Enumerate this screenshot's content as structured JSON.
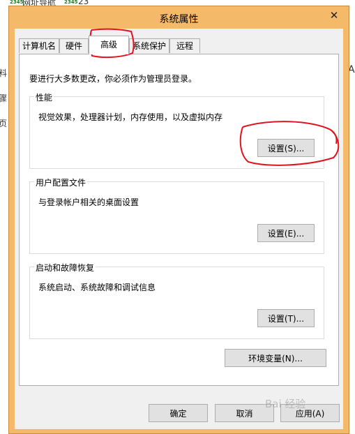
{
  "background": {
    "top_link": "网址导航",
    "top_num": "23",
    "badge": "2345",
    "left_fragments": [
      "料",
      "骤",
      "页"
    ],
    "right_fragment": "A"
  },
  "window": {
    "title": "系统属性",
    "close_glyph": "✕"
  },
  "tabs": [
    {
      "label": "计算机名"
    },
    {
      "label": "硬件"
    },
    {
      "label": "高级"
    },
    {
      "label": "系统保护"
    },
    {
      "label": "远程"
    }
  ],
  "active_tab": "高级",
  "admin_note": "要进行大多数更改，你必须作为管理员登录。",
  "groups": {
    "performance": {
      "title": "性能",
      "desc": "视觉效果，处理器计划，内存使用，以及虚拟内存",
      "button": "设置(S)..."
    },
    "user_profiles": {
      "title": "用户配置文件",
      "desc": "与登录帐户相关的桌面设置",
      "button": "设置(E)..."
    },
    "startup_recovery": {
      "title": "启动和故障恢复",
      "desc": "系统启动、系统故障和调试信息",
      "button": "设置(T)..."
    }
  },
  "env_button": "环境变量(N)...",
  "footer": {
    "ok": "确定",
    "cancel": "取消",
    "apply": "应用(A)"
  },
  "watermark": "Bai 经验",
  "annotation_color": "#e0141e"
}
